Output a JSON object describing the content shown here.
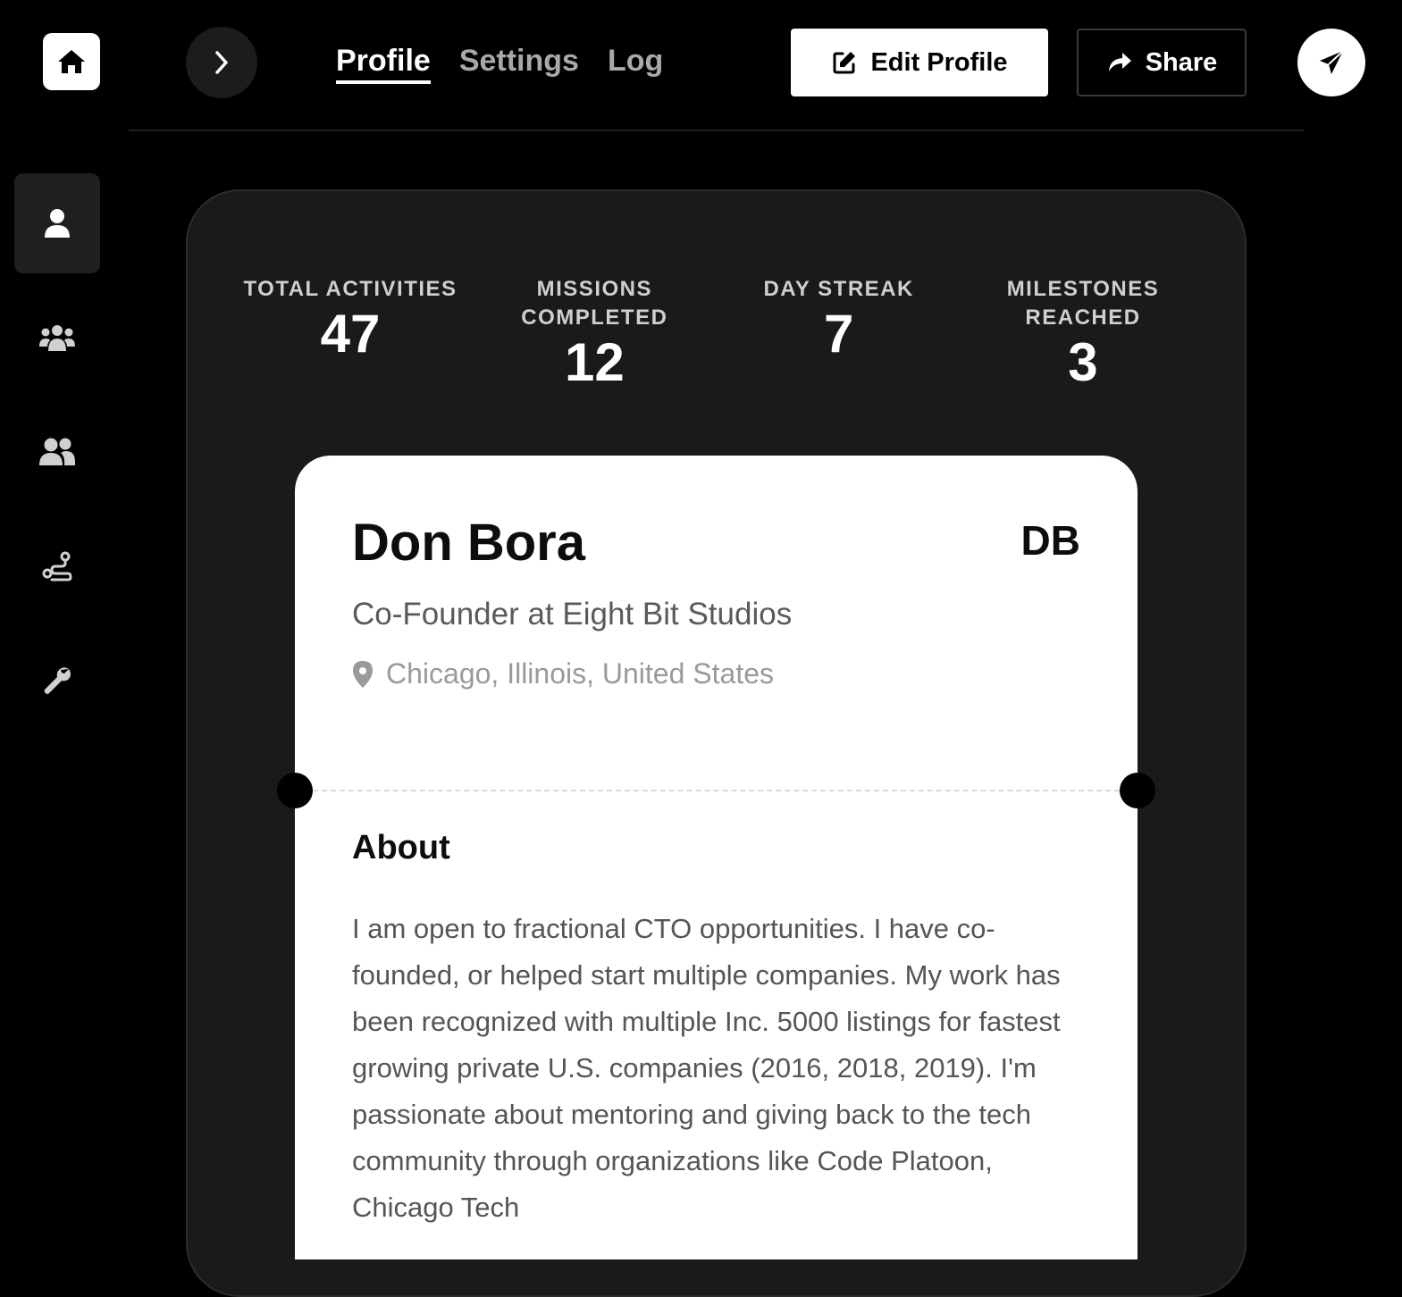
{
  "nav": {
    "home_icon": "home-icon",
    "forward_icon": "chevron-right-icon",
    "tabs": [
      {
        "label": "Profile",
        "active": true
      },
      {
        "label": "Settings",
        "active": false
      },
      {
        "label": "Log",
        "active": false
      }
    ],
    "edit_label": "Edit Profile",
    "share_label": "Share"
  },
  "sidebar": {
    "items": [
      {
        "icon": "user-icon",
        "active": true
      },
      {
        "icon": "users-group-icon",
        "active": false
      },
      {
        "icon": "user-friends-icon",
        "active": false
      },
      {
        "icon": "route-icon",
        "active": false
      },
      {
        "icon": "wrench-icon",
        "active": false
      }
    ]
  },
  "stats": [
    {
      "label": "Total Activities",
      "value": "47"
    },
    {
      "label": "Missions Completed",
      "value": "12"
    },
    {
      "label": "Day Streak",
      "value": "7"
    },
    {
      "label": "Milestones Reached",
      "value": "3"
    }
  ],
  "profile": {
    "name": "Don Bora",
    "initials": "DB",
    "headline": "Co-Founder at Eight Bit Studios",
    "location": "Chicago, Illinois, United States",
    "about_title": "About",
    "about_text": "I am open to fractional CTO opportunities. I have co-founded, or helped start multiple companies. My work has been recognized with multiple Inc. 5000 listings for fastest growing private U.S. companies (2016, 2018, 2019). I'm passionate about mentoring and giving back to the tech community through organizations like Code Platoon, Chicago Tech"
  },
  "colors": {
    "background": "#000000",
    "card_dark": "#1a1a1a",
    "card_light": "#ffffff",
    "muted_text": "#a9a9a9"
  }
}
